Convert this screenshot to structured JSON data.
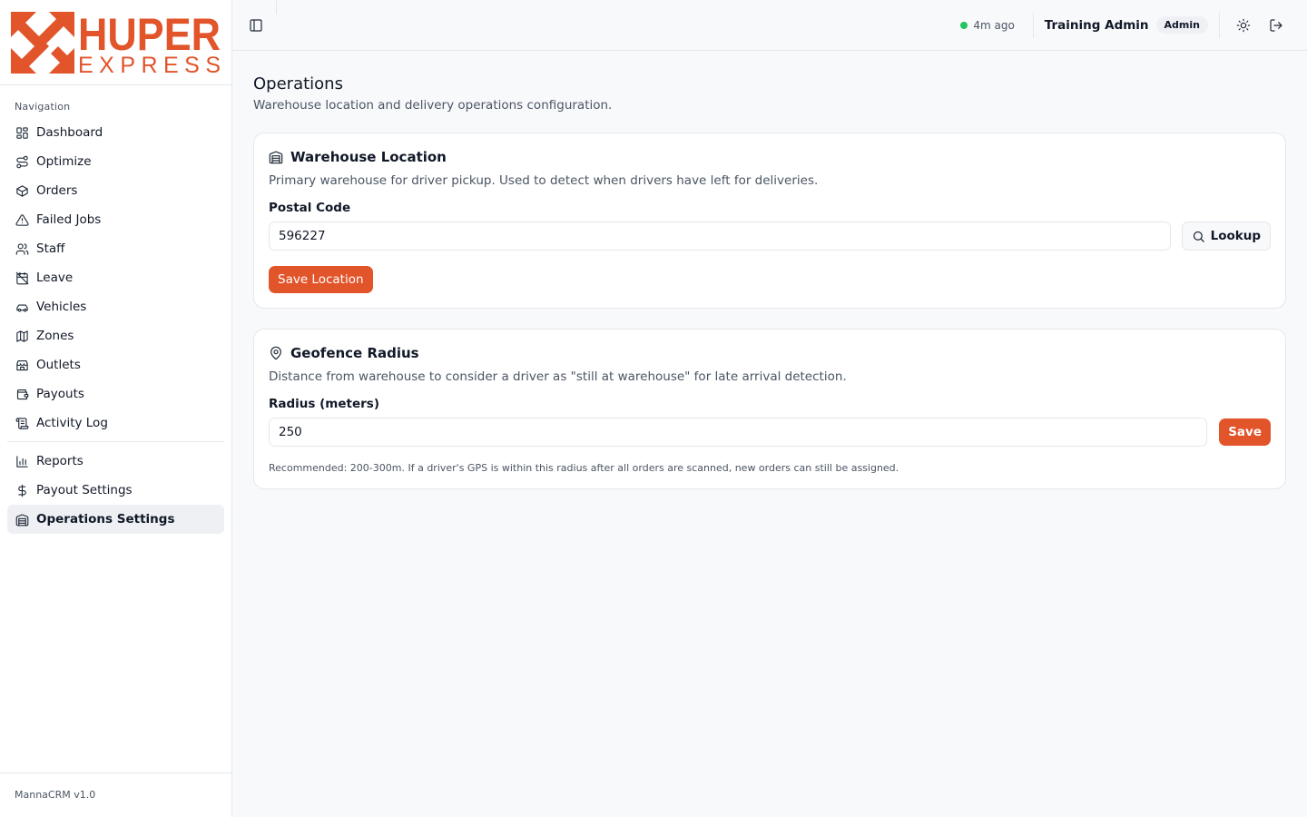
{
  "brand": {
    "name_top": "HUPER",
    "name_bottom": "EXPRESS",
    "accent": "#e2542a"
  },
  "sidebar": {
    "heading": "Navigation",
    "items": [
      {
        "label": "Dashboard",
        "icon": "dashboard-icon"
      },
      {
        "label": "Optimize",
        "icon": "route-icon"
      },
      {
        "label": "Orders",
        "icon": "package-icon"
      },
      {
        "label": "Failed Jobs",
        "icon": "warning-icon"
      },
      {
        "label": "Staff",
        "icon": "users-icon"
      },
      {
        "label": "Leave",
        "icon": "calendar-off-icon"
      },
      {
        "label": "Vehicles",
        "icon": "car-icon"
      },
      {
        "label": "Zones",
        "icon": "map-icon"
      },
      {
        "label": "Outlets",
        "icon": "store-icon"
      },
      {
        "label": "Payouts",
        "icon": "wallet-icon"
      },
      {
        "label": "Activity Log",
        "icon": "scroll-icon"
      }
    ],
    "secondary_items": [
      {
        "label": "Reports",
        "icon": "bar-chart-icon"
      },
      {
        "label": "Payout Settings",
        "icon": "dollar-icon"
      },
      {
        "label": "Operations Settings",
        "icon": "warehouse-icon",
        "active": true
      }
    ],
    "footer": "MannaCRM v1.0"
  },
  "topbar": {
    "status_text": "4m ago",
    "status_color": "#22c55e",
    "user_name": "Training Admin",
    "role": "Admin"
  },
  "page": {
    "title": "Operations",
    "subtitle": "Warehouse location and delivery operations configuration."
  },
  "warehouse_card": {
    "title": "Warehouse Location",
    "description": "Primary warehouse for driver pickup. Used to detect when drivers have left for deliveries.",
    "field_label": "Postal Code",
    "postal_code": "596227",
    "lookup_label": "Lookup",
    "save_label": "Save Location"
  },
  "geofence_card": {
    "title": "Geofence Radius",
    "description": "Distance from warehouse to consider a driver as \"still at warehouse\" for late arrival detection.",
    "field_label": "Radius (meters)",
    "radius": "250",
    "save_label": "Save",
    "hint": "Recommended: 200-300m. If a driver's GPS is within this radius after all orders are scanned, new orders can still be assigned."
  }
}
